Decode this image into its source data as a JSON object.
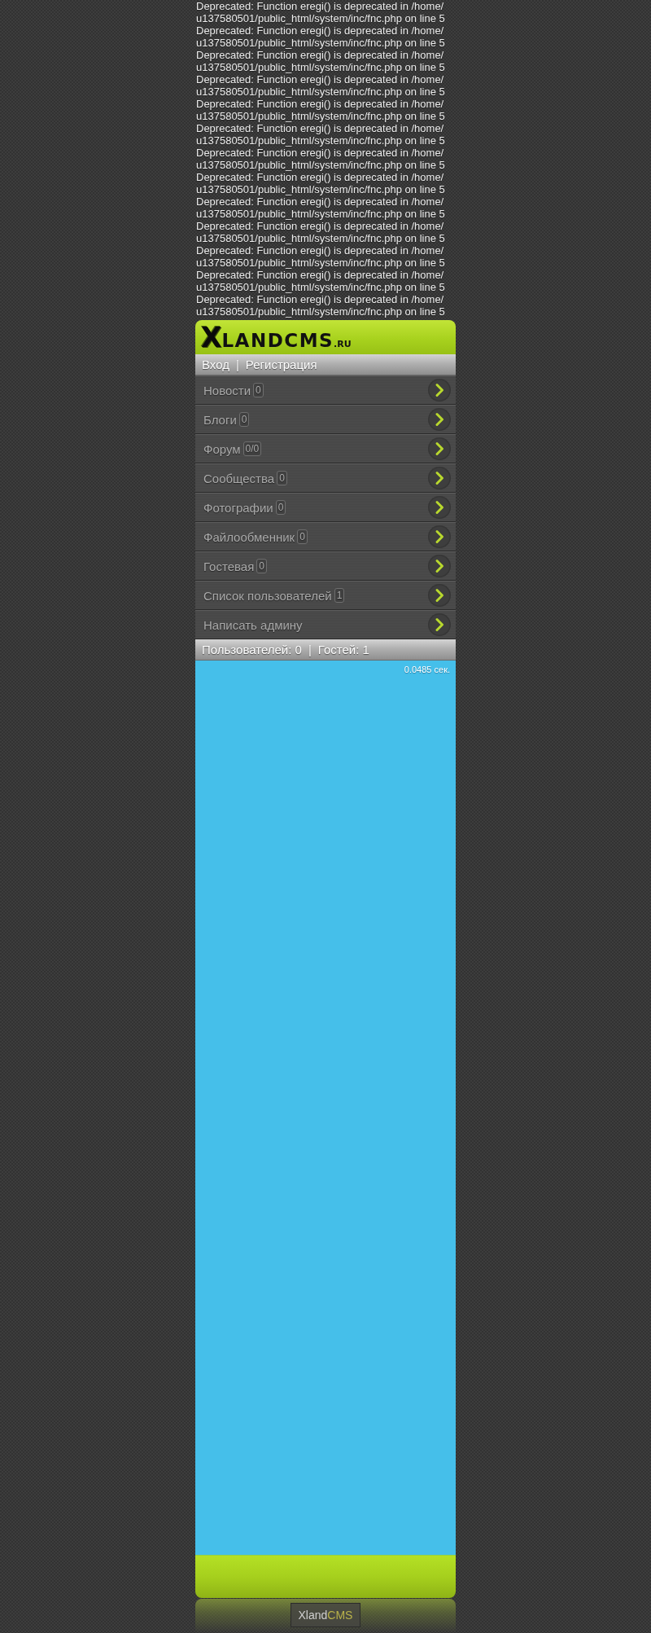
{
  "warnings": [
    "Deprecated: Function eregi() is deprecated in /home/u137580501/public_html/system/inc/fnc.php on line 5",
    "Deprecated: Function eregi() is deprecated in /home/u137580501/public_html/system/inc/fnc.php on line 5",
    "Deprecated: Function eregi() is deprecated in /home/u137580501/public_html/system/inc/fnc.php on line 5",
    "Deprecated: Function eregi() is deprecated in /home/u137580501/public_html/system/inc/fnc.php on line 5",
    "Deprecated: Function eregi() is deprecated in /home/u137580501/public_html/system/inc/fnc.php on line 5",
    "Deprecated: Function eregi() is deprecated in /home/u137580501/public_html/system/inc/fnc.php on line 5",
    "Deprecated: Function eregi() is deprecated in /home/u137580501/public_html/system/inc/fnc.php on line 5",
    "Deprecated: Function eregi() is deprecated in /home/u137580501/public_html/system/inc/fnc.php on line 5",
    "Deprecated: Function eregi() is deprecated in /home/u137580501/public_html/system/inc/fnc.php on line 5",
    "Deprecated: Function eregi() is deprecated in /home/u137580501/public_html/system/inc/fnc.php on line 5",
    "Deprecated: Function eregi() is deprecated in /home/u137580501/public_html/system/inc/fnc.php on line 5",
    "Deprecated: Function eregi() is deprecated in /home/u137580501/public_html/system/inc/fnc.php on line 5",
    "Deprecated: Function eregi() is deprecated in /home/u137580501/public_html/system/inc/fnc.php on line 5"
  ],
  "header": {
    "logo_mark": "X",
    "logo": "LANDCMS",
    "logo_suffix": ".RU"
  },
  "auth": {
    "links": [
      {
        "label": "Вход"
      },
      {
        "label": "Регистрация"
      }
    ],
    "separator": "|"
  },
  "menu": [
    {
      "label": "Новости",
      "count": "0"
    },
    {
      "label": "Блоги",
      "count": "0"
    },
    {
      "label": "Форум",
      "count": "0/0"
    },
    {
      "label": "Сообщества",
      "count": "0"
    },
    {
      "label": "Фотографии",
      "count": "0"
    },
    {
      "label": "Файлообменник",
      "count": "0"
    },
    {
      "label": "Гостевая",
      "count": "0"
    },
    {
      "label": "Список пользователей",
      "count": "1"
    },
    {
      "label": "Написать админу"
    }
  ],
  "stats": {
    "items": [
      "Пользователей: 0",
      "Гостей: 1"
    ],
    "separator": "|"
  },
  "content": {
    "generation_time": "0.0485 сек."
  },
  "footer": {
    "brand": "Xland",
    "brand_accent": "CMS"
  }
}
